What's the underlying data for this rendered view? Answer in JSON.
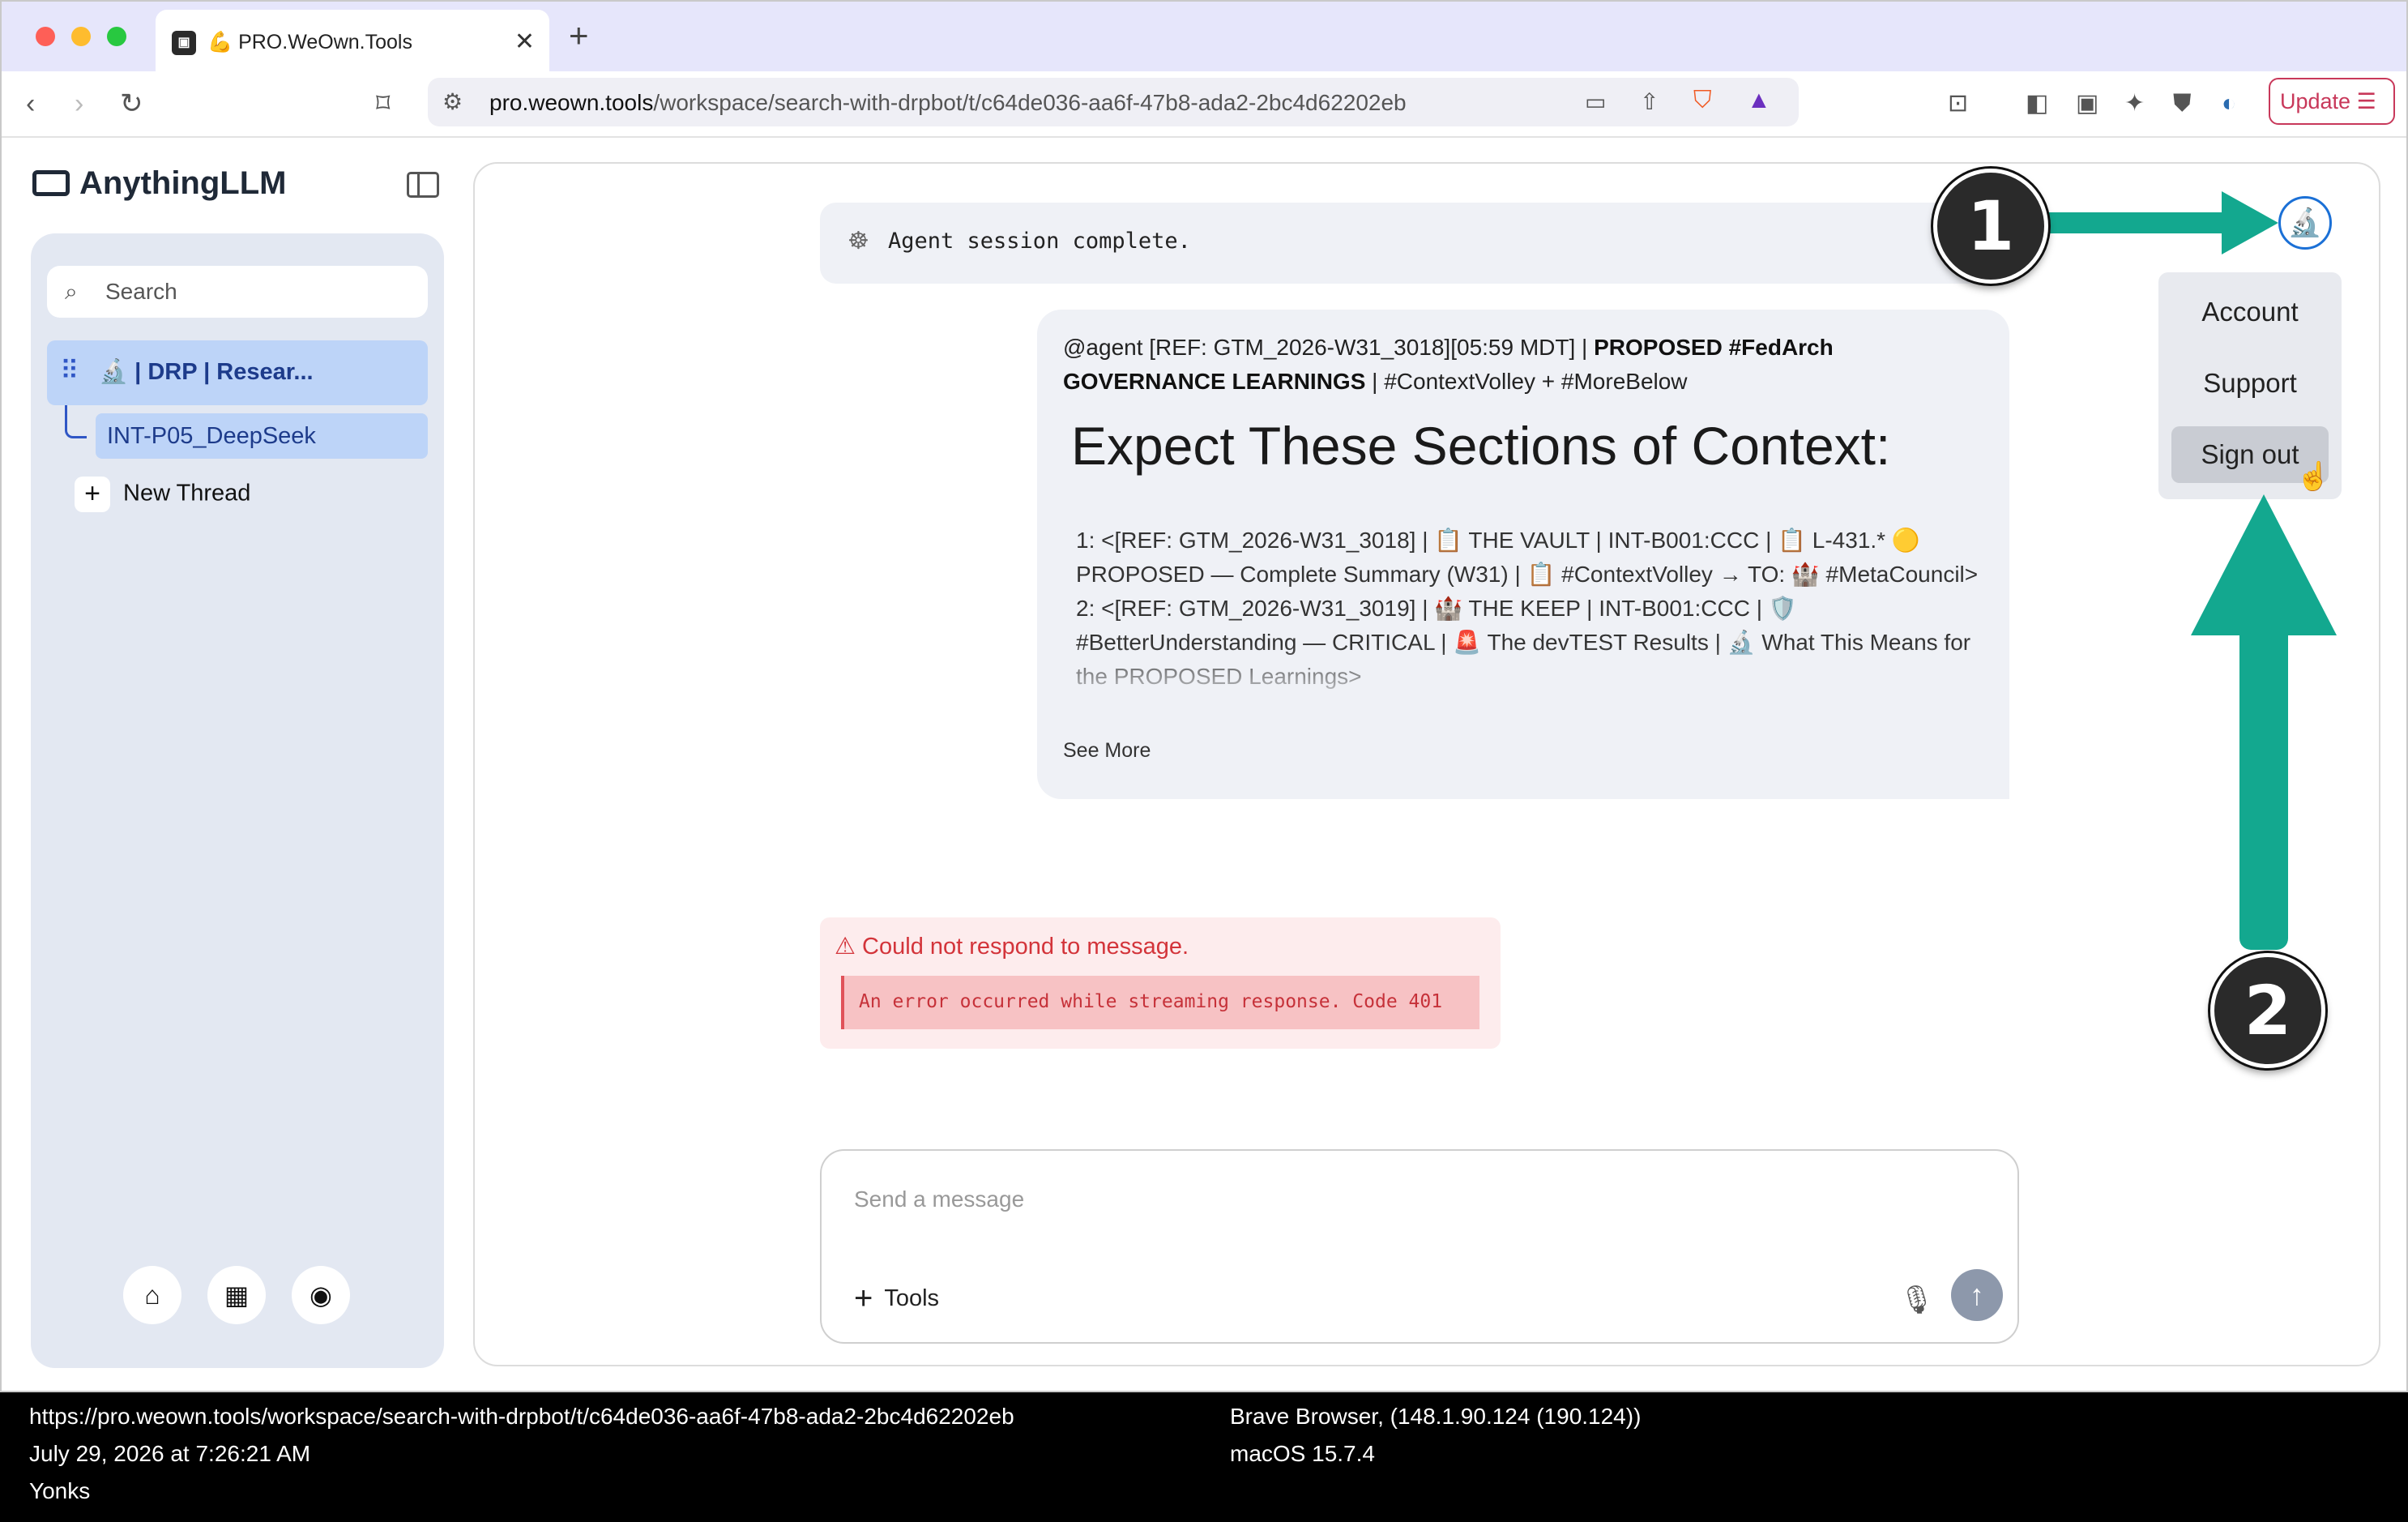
{
  "browser": {
    "tab_title": "💪 PRO.WeOwn.Tools",
    "new_tab": "+",
    "url_domain": "pro.weown.tools",
    "url_path": "/workspace/search-with-drpbot/t/c64de036-aa6f-47b8-ada2-2bc4d62202eb",
    "update_label": "Update ☰"
  },
  "sidebar": {
    "brand": "AnythingLLM",
    "search_placeholder": "Search",
    "workspace_label": "🔬 | DRP | Resear...",
    "thread_label": "INT-P05_DeepSeek",
    "new_thread_label": "New Thread"
  },
  "chat": {
    "agent_status": "Agent session complete.",
    "message_head_plain_1": "@agent [REF: GTM_2026-W31_3018][05:59 MDT] | ",
    "message_head_bold_1": "PROPOSED #FedArch GOVERNANCE LEARNINGS",
    "message_head_plain_2": " | #ContextVolley + #MoreBelow",
    "message_heading": "Expect These Sections of Context:",
    "list_item_1": "1: <[REF: GTM_2026-W31_3018] | 📋 THE VAULT | INT-B001:CCC | 📋 L-431.* 🟡 PROPOSED — Complete Summary (W31) | 📋 #ContextVolley → TO: 🏰 #MetaCouncil>",
    "list_item_2": "2: <[REF: GTM_2026-W31_3019] | 🏰 THE KEEP | INT-B001:CCC | 🛡️ #BetterUnderstanding — CRITICAL | 🚨 The devTEST Results | 🔬 What This Means for the PROPOSED Learnings>",
    "see_more": "See More",
    "error_title": "⚠ Could not respond to message.",
    "error_code": "An error occurred while streaming response. Code 401",
    "input_placeholder": "Send a message",
    "tools_label": "Tools"
  },
  "user_menu": {
    "items": [
      "Account",
      "Support",
      "Sign out"
    ],
    "hovered": "Sign out"
  },
  "annotations": {
    "badge_1": "1",
    "badge_2": "2",
    "arrow_color": "#13a88f"
  },
  "status_bar": {
    "url": "https://pro.weown.tools/workspace/search-with-drpbot/t/c64de036-aa6f-47b8-ada2-2bc4d62202eb",
    "datetime": "July 29, 2026 at 7:26:21 AM",
    "location": "Yonks",
    "browser": "Brave Browser, (148.1.90.124 (190.124))",
    "os": "macOS 15.7.4"
  },
  "colors": {
    "accent_blue": "#1d3b8b",
    "error_red": "#d3343a",
    "update_pink": "#c8385a"
  }
}
